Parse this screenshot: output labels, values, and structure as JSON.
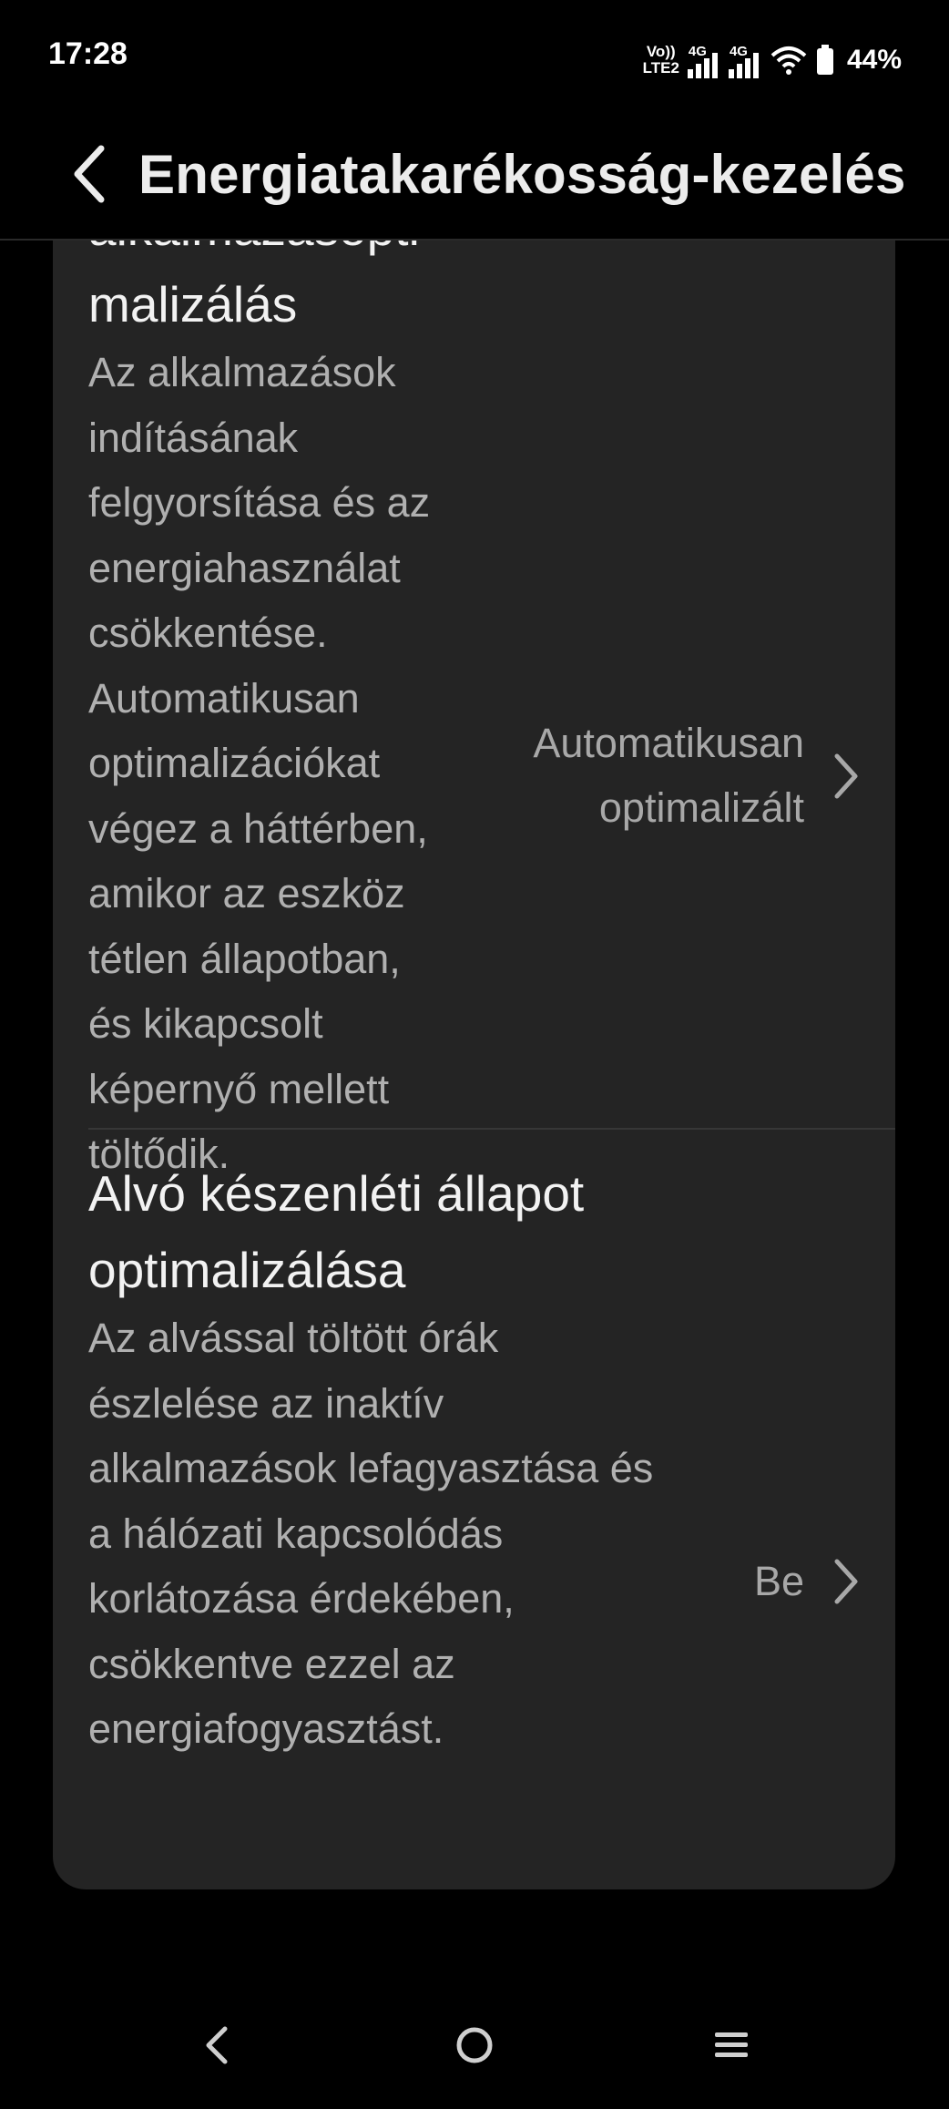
{
  "status_bar": {
    "time": "17:28",
    "volte_line1": "Vo))",
    "volte_line2": "LTE2",
    "sim1_network": "4G",
    "sim2_network": "4G",
    "battery_percent": "44%"
  },
  "header": {
    "title": "Energiatakarékosság-kezelés",
    "back_icon": "chevron-left-icon"
  },
  "settings": [
    {
      "title_partial": "alkalmazásopti",
      "title": "malizálás",
      "description": [
        "Az alkalmazások",
        "indításának",
        "felgyorsítása és az",
        "energiahasználat",
        "csökkentése.",
        "Automatikusan",
        "optimalizációkat",
        "végez a háttérben,",
        "amikor az eszköz",
        "tétlen állapotban,",
        "és kikapcsolt",
        "képernyő mellett",
        "töltődik."
      ],
      "value": [
        "Automatikusan",
        "optimalizált"
      ]
    },
    {
      "title": [
        "Alvó készenléti állapot",
        "optimalizálása"
      ],
      "description": [
        "Az alvással töltött órák",
        "észlelése az inaktív",
        "alkalmazások lefagyasztása és",
        "a hálózati kapcsolódás",
        "korlátozása érdekében,",
        "csökkentve ezzel az",
        "energiafogyasztást."
      ],
      "value": "Be"
    }
  ],
  "nav_bar": {
    "back": "nav-back-icon",
    "home": "nav-home-icon",
    "recents": "nav-recents-icon"
  },
  "colors": {
    "background": "#000000",
    "card": "#242424",
    "title_text": "#f2f2f2",
    "desc_text": "#b0b0b0"
  }
}
